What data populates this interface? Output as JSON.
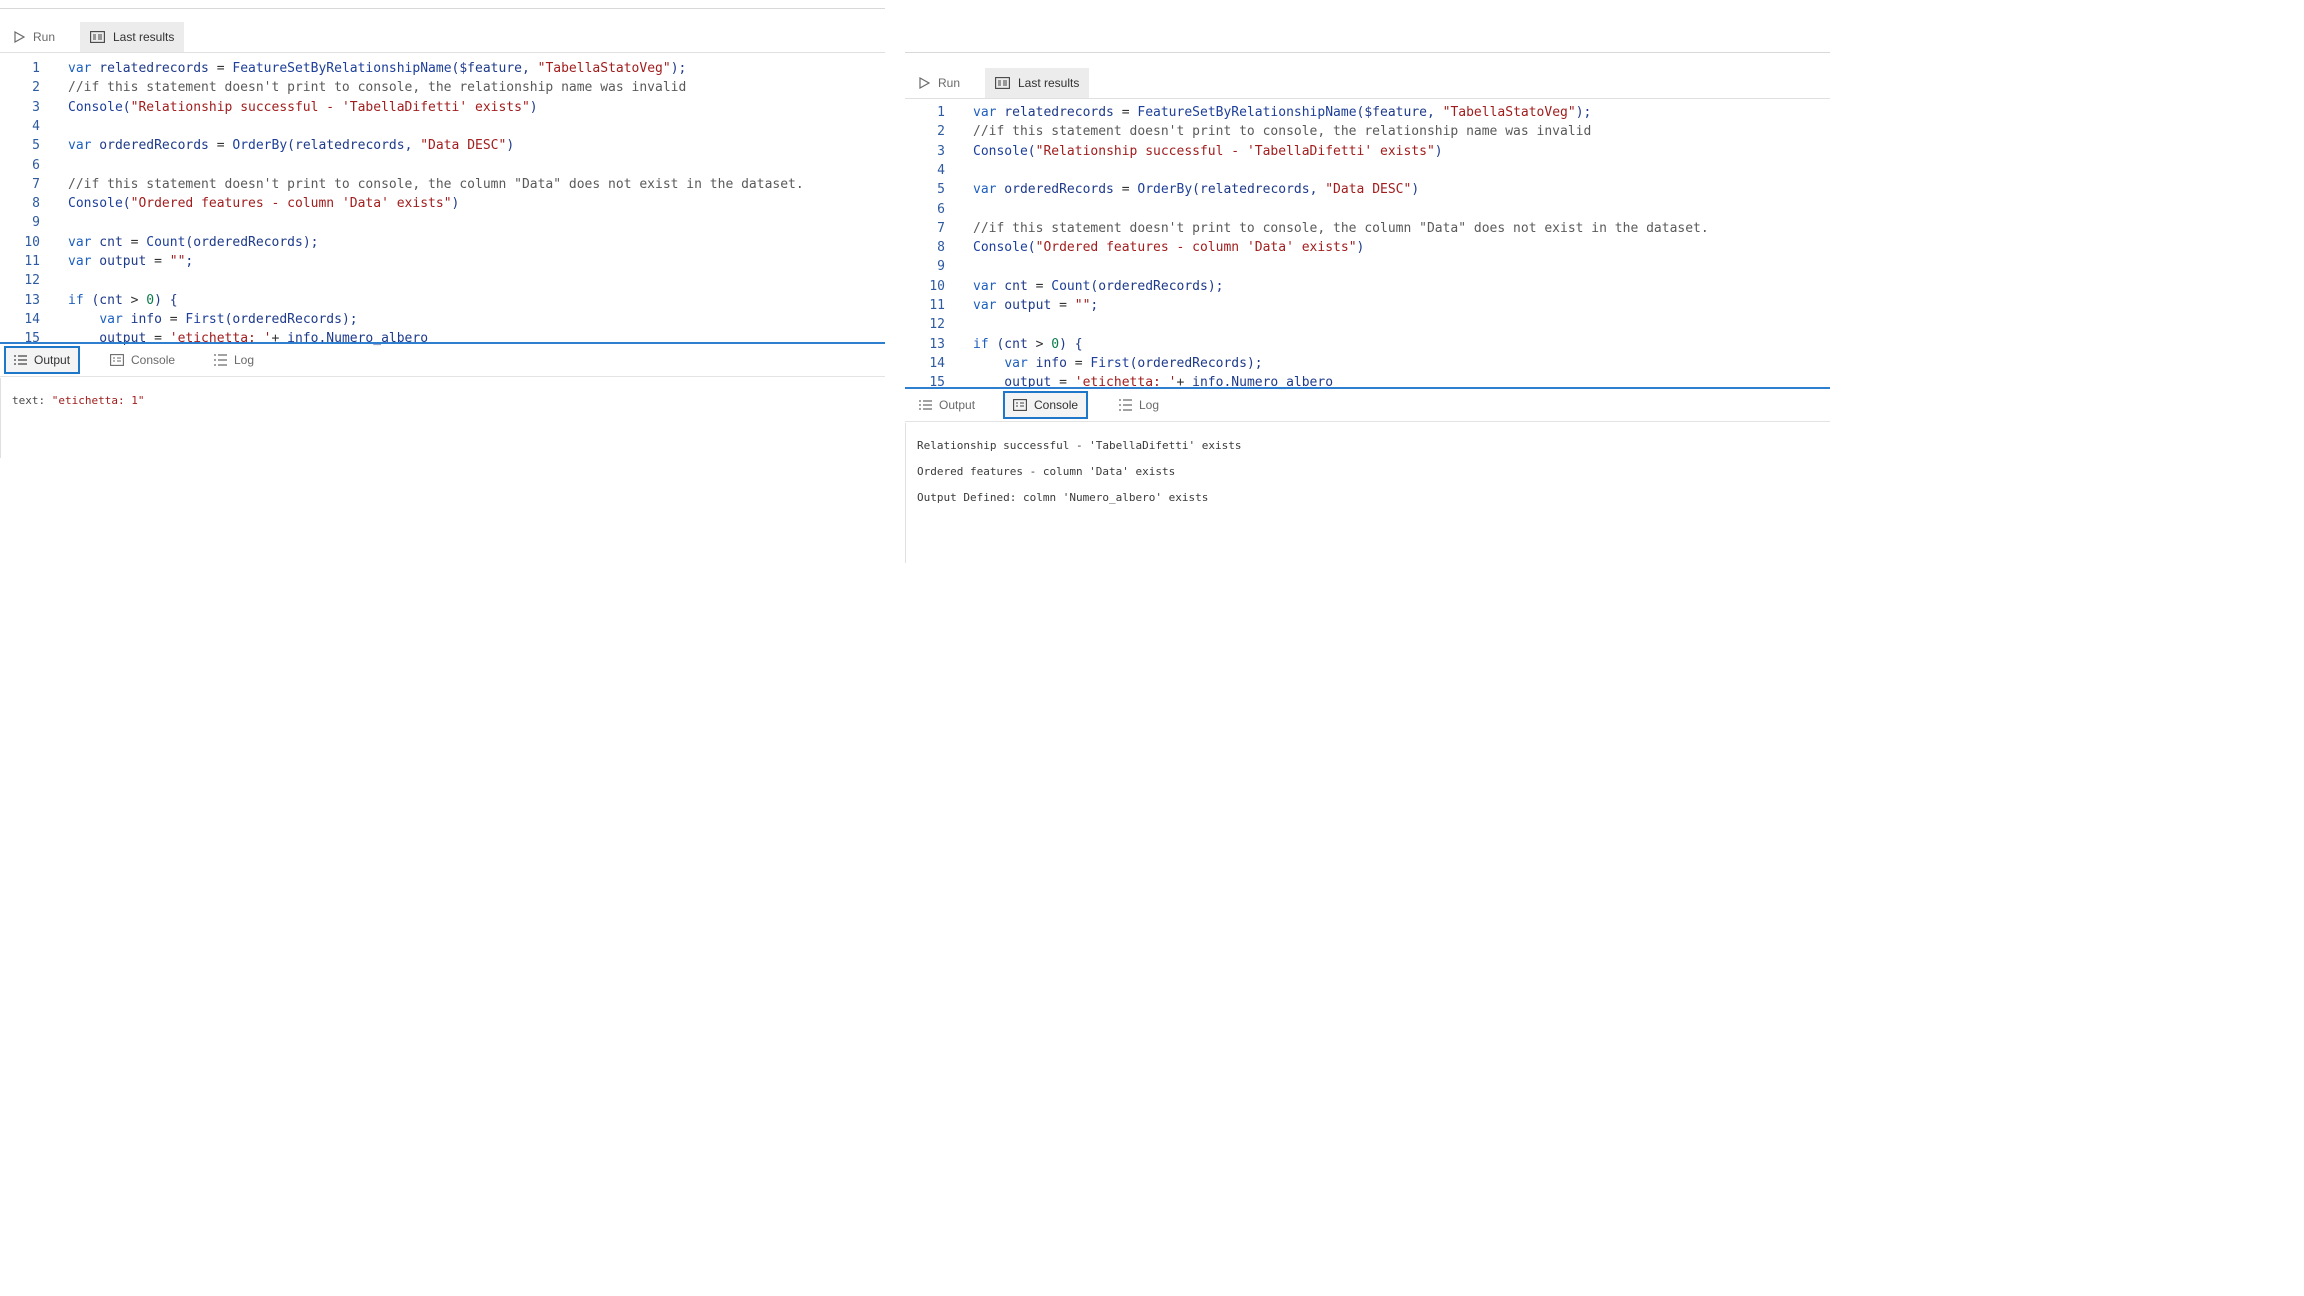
{
  "toolbar": {
    "run_label": "Run",
    "last_results_label": "Last results"
  },
  "tabs": {
    "output": "Output",
    "console": "Console",
    "log": "Log"
  },
  "code_lines": [
    {
      "n": "1",
      "html": "<span class=\"kw\">var</span> relatedrecords <span class=\"op\">=</span> <span class=\"fn\">FeatureSetByRelationshipName</span>($feature, <span class=\"str\">\"TabellaStatoVeg\"</span>);"
    },
    {
      "n": "2",
      "html": "<span class=\"cm\">//if this statement doesn't print to console, the relationship name was invalid</span>"
    },
    {
      "n": "3",
      "html": "<span class=\"fn\">Console</span>(<span class=\"str\">\"Relationship successful - 'TabellaDifetti' exists\"</span>)"
    },
    {
      "n": "4",
      "html": ""
    },
    {
      "n": "5",
      "html": "<span class=\"kw\">var</span> orderedRecords <span class=\"op\">=</span> <span class=\"fn\">OrderBy</span>(relatedrecords, <span class=\"str\">\"Data DESC\"</span>)"
    },
    {
      "n": "6",
      "html": ""
    },
    {
      "n": "7",
      "html": "<span class=\"cm\">//if this statement doesn't print to console, the column \"Data\" does not exist in the dataset.</span>"
    },
    {
      "n": "8",
      "html": "<span class=\"fn\">Console</span>(<span class=\"str\">\"Ordered features - column 'Data' exists\"</span>)"
    },
    {
      "n": "9",
      "html": ""
    },
    {
      "n": "10",
      "html": "<span class=\"kw\">var</span> cnt <span class=\"op\">=</span> <span class=\"fn\">Count</span>(orderedRecords);"
    },
    {
      "n": "11",
      "html": "<span class=\"kw\">var</span> output <span class=\"op\">=</span> <span class=\"str\">\"\"</span>;"
    },
    {
      "n": "12",
      "html": ""
    },
    {
      "n": "13",
      "html": "<span class=\"kw\">if</span> (cnt <span class=\"op\">&gt;</span> <span class=\"num\">0</span>) {"
    },
    {
      "n": "14",
      "html": "    <span class=\"kw\">var</span> info <span class=\"op\">=</span> <span class=\"fn\">First</span>(orderedRecords);"
    },
    {
      "n": "15",
      "html": "    output <span class=\"op\">=</span> <span class=\"str\">'etichetta: '</span><span class=\"op\">+</span> info.Numero_albero"
    }
  ],
  "left_output": {
    "key": "text:",
    "value": "\"etichetta: 1\""
  },
  "right_console": [
    "Relationship successful - 'TabellaDifetti' exists",
    "Ordered features - column 'Data' exists",
    "Output Defined: colmn 'Numero_albero' exists"
  ]
}
